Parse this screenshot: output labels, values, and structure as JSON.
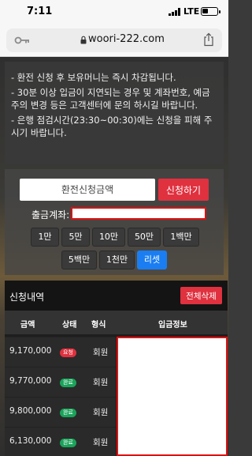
{
  "status_bar": {
    "time": "7:11",
    "network": "LTE"
  },
  "browser": {
    "url": "woori-222.com"
  },
  "notice": {
    "lines": [
      "- 환전 신청 후 보유머니는 즉시 차감됩니다.",
      "- 30분 이상 입금이 지연되는 경우 및 계좌번호, 예금주의 변경 등은 고객센터에 문의 하시길 바랍니다.",
      "- 은행 점검시간(23:30~00:30)에는 신청을 피해 주시기 바랍니다."
    ]
  },
  "form": {
    "amount_placeholder": "환전신청금액",
    "apply_label": "신청하기",
    "account_label": "출금계좌:",
    "chips_row1": [
      "1만",
      "5만",
      "10만",
      "50만",
      "1백만"
    ],
    "chips_row2": [
      "5백만",
      "1천만",
      "리셋"
    ]
  },
  "history": {
    "title": "신청내역",
    "delete_all_label": "전체삭제",
    "columns": [
      "금액",
      "상태",
      "형식",
      "입금정보"
    ],
    "rows": [
      {
        "amount": "9,170,000",
        "status": "요청",
        "status_color": "#e0313f",
        "type": "회원"
      },
      {
        "amount": "9,770,000",
        "status": "완료",
        "status_color": "#1aa35a",
        "type": "회원"
      },
      {
        "amount": "9,800,000",
        "status": "완료",
        "status_color": "#1aa35a",
        "type": "회원"
      },
      {
        "amount": "6,130,000",
        "status": "완료",
        "status_color": "#1aa35a",
        "type": "회원"
      }
    ]
  },
  "colors": {
    "accent_red": "#e0313f",
    "accent_blue": "#1a7ef2"
  }
}
